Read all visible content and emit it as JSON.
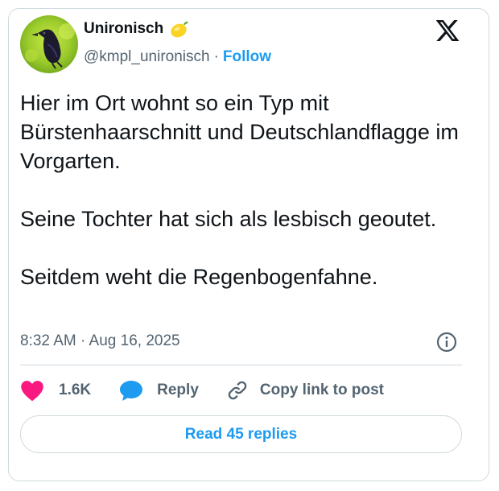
{
  "author": {
    "display_name": "Unironisch",
    "badge_icon": "lemon-emoji",
    "handle": "@kmpl_unironisch",
    "separator": "·",
    "follow_label": "Follow"
  },
  "tweet": {
    "paragraphs": [
      "Hier im Ort wohnt so ein Typ mit Bürstenhaarschnitt und Deutschlandflagge im Vorgarten.",
      "Seine Tochter hat sich als lesbisch geoutet.",
      "Seitdem weht die Regenbogenfahne."
    ],
    "timestamp": "8:32 AM · Aug 16, 2025"
  },
  "actions": {
    "like_count": "1.6K",
    "reply_label": "Reply",
    "copy_label": "Copy link to post"
  },
  "read_replies_label": "Read 45 replies",
  "colors": {
    "accent": "#1d9bf0",
    "heart": "#f91880",
    "text": "#0f1419",
    "muted": "#536471",
    "border": "#cfd9de"
  }
}
